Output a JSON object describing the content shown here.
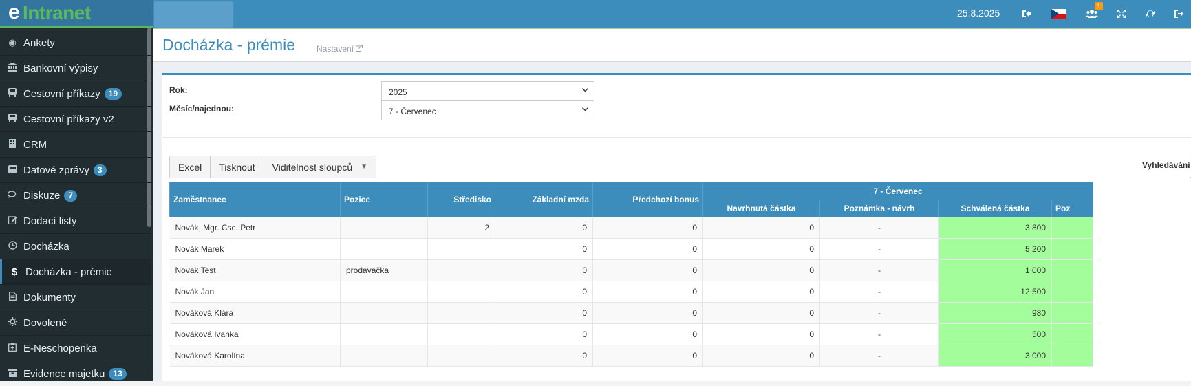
{
  "app": {
    "logo_e": "e",
    "logo_rest": "Intranet",
    "date": "25.8.2025",
    "notification_count": "1",
    "language_flag": "cz-flag",
    "icons": [
      "sign-out-icon",
      "cz-flag",
      "users-icon",
      "fullscreen-icon",
      "refresh-icon",
      "logout-icon"
    ]
  },
  "sidebar": {
    "items": [
      {
        "label": "Ankety",
        "icon": "poll-icon",
        "badge": ""
      },
      {
        "label": "Bankovní výpisy",
        "icon": "bank-icon",
        "badge": ""
      },
      {
        "label": "Cestovní příkazy",
        "icon": "bus-icon",
        "badge": "19"
      },
      {
        "label": "Cestovní příkazy v2",
        "icon": "bus-icon",
        "badge": ""
      },
      {
        "label": "CRM",
        "icon": "building-icon",
        "badge": ""
      },
      {
        "label": "Datové zprávy",
        "icon": "inbox-icon",
        "badge": "3"
      },
      {
        "label": "Diskuze",
        "icon": "comments-icon",
        "badge": "7"
      },
      {
        "label": "Dodací listy",
        "icon": "edit-icon",
        "badge": ""
      },
      {
        "label": "Docházka",
        "icon": "clock-icon",
        "badge": ""
      },
      {
        "label": "Docházka - prémie",
        "icon": "dollar-icon",
        "badge": ""
      },
      {
        "label": "Dokumenty",
        "icon": "file-icon",
        "badge": ""
      },
      {
        "label": "Dovolené",
        "icon": "sun-icon",
        "badge": ""
      },
      {
        "label": "E-Neschopenka",
        "icon": "hospital-icon",
        "badge": ""
      },
      {
        "label": "Evidence majetku",
        "icon": "archive-icon",
        "badge": "13"
      }
    ]
  },
  "page": {
    "title": "Docházka - prémie",
    "settings_link": "Nastavení"
  },
  "filters": {
    "year_label": "Rok:",
    "year_value": "2025",
    "month_label": "Měsíc/najednou:",
    "month_value": "7 - Červenec"
  },
  "toolbar": {
    "excel": "Excel",
    "print": "Tisknout",
    "columns": "Viditelnost sloupců",
    "search_label": "Vyhledávání:"
  },
  "table": {
    "headers": {
      "employee": "Zaměstnanec",
      "position": "Pozice",
      "center": "Středisko",
      "base_salary": "Základní mzda",
      "prev_bonus": "Předchozí bonus",
      "group": "7 - Červenec",
      "proposed": "Navrhnutá částka",
      "note_proposal": "Poznámka - návrh",
      "approved": "Schválená částka",
      "truncated": "Poz"
    },
    "rows": [
      {
        "employee": "Novák, Mgr. Csc. Petr",
        "position": "",
        "center": "2",
        "base_salary": "0",
        "prev_bonus": "0",
        "proposed": "0",
        "note": "-",
        "approved": "3 800"
      },
      {
        "employee": "Novák Marek",
        "position": "",
        "center": "",
        "base_salary": "0",
        "prev_bonus": "0",
        "proposed": "0",
        "note": "-",
        "approved": "5 200"
      },
      {
        "employee": "Novak Test",
        "position": "prodavačka",
        "center": "",
        "base_salary": "0",
        "prev_bonus": "0",
        "proposed": "0",
        "note": "-",
        "approved": "1 000"
      },
      {
        "employee": "Novák Jan",
        "position": "",
        "center": "",
        "base_salary": "0",
        "prev_bonus": "0",
        "proposed": "0",
        "note": "-",
        "approved": "12 500"
      },
      {
        "employee": "Nováková Klára",
        "position": "",
        "center": "",
        "base_salary": "0",
        "prev_bonus": "0",
        "proposed": "0",
        "note": "-",
        "approved": "980"
      },
      {
        "employee": "Nováková Ivanka",
        "position": "",
        "center": "",
        "base_salary": "0",
        "prev_bonus": "0",
        "proposed": "0",
        "note": "-",
        "approved": "500"
      },
      {
        "employee": "Nováková Karolína",
        "position": "",
        "center": "",
        "base_salary": "0",
        "prev_bonus": "0",
        "proposed": "0",
        "note": "-",
        "approved": "3 000"
      }
    ]
  },
  "colors": {
    "brand_blue": "#3c8dbc",
    "sidebar_bg": "#222d32",
    "approved_green": "#a4fd9b",
    "logo_green": "#5cb85c"
  }
}
